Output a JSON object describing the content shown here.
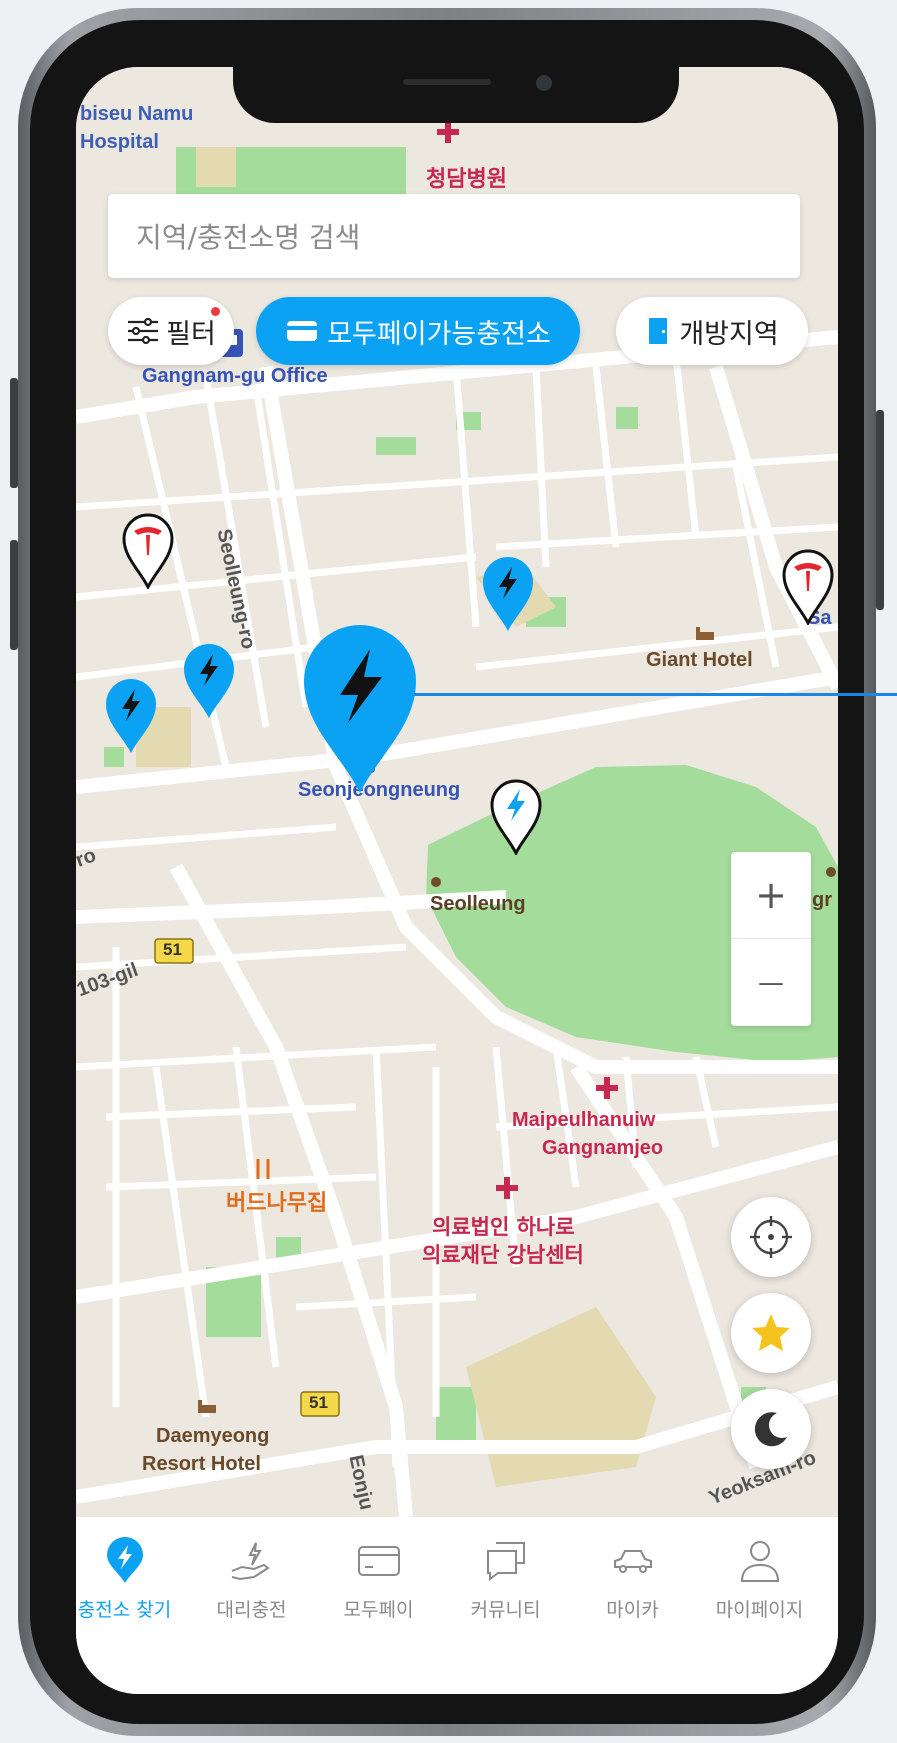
{
  "search": {
    "placeholder": "지역/충전소명 검색"
  },
  "filters": {
    "filter_label": "필터",
    "modupay_label": "모두페이가능충전소",
    "open_area_label": "개방지역"
  },
  "map_labels": {
    "hospital_top_en_1": "biseu Namu",
    "hospital_top_en_2": "Hospital",
    "hospital_top_kr": "청담병원",
    "gangnam_office": "Gangnam-gu Office",
    "seolleung_road": "Seolleung-ro",
    "giant_hotel": "Giant Hotel",
    "seonjeongneung": "Seonjeongneung",
    "seolleung": "Seolleung",
    "ro_left": "ro",
    "gil_103": "103-gil",
    "route_51": "51",
    "restaurant": "버드나무집",
    "maple_1": "Maipeulhanuiw",
    "maple_2": "Gangnamjeo",
    "hana_1": "의료법인 하나로",
    "hana_2": "의료재단 강남센터",
    "daemyeong_1": "Daemyeong",
    "daemyeong_2": "Resort Hotel",
    "eonju": "Eonju",
    "yeoksam": "Yeoksam-ro",
    "sa_right": "Sa",
    "gr_right": "gr"
  },
  "zoom": {
    "in_label": "+",
    "out_label": "—"
  },
  "tabs": [
    {
      "label": "충전소 찾기",
      "icon": "charging-pin-icon",
      "active": true
    },
    {
      "label": "대리충전",
      "icon": "hand-charge-icon",
      "active": false
    },
    {
      "label": "모두페이",
      "icon": "card-icon",
      "active": false
    },
    {
      "label": "커뮤니티",
      "icon": "chat-icon",
      "active": false
    },
    {
      "label": "마이카",
      "icon": "car-icon",
      "active": false
    },
    {
      "label": "마이페이지",
      "icon": "person-icon",
      "active": false
    }
  ],
  "colors": {
    "accent": "#0ba2f4",
    "tesla_red": "#e4262f",
    "map_bg": "#ece7df",
    "park": "#a4dc9b",
    "hospital": "#c6284f"
  }
}
